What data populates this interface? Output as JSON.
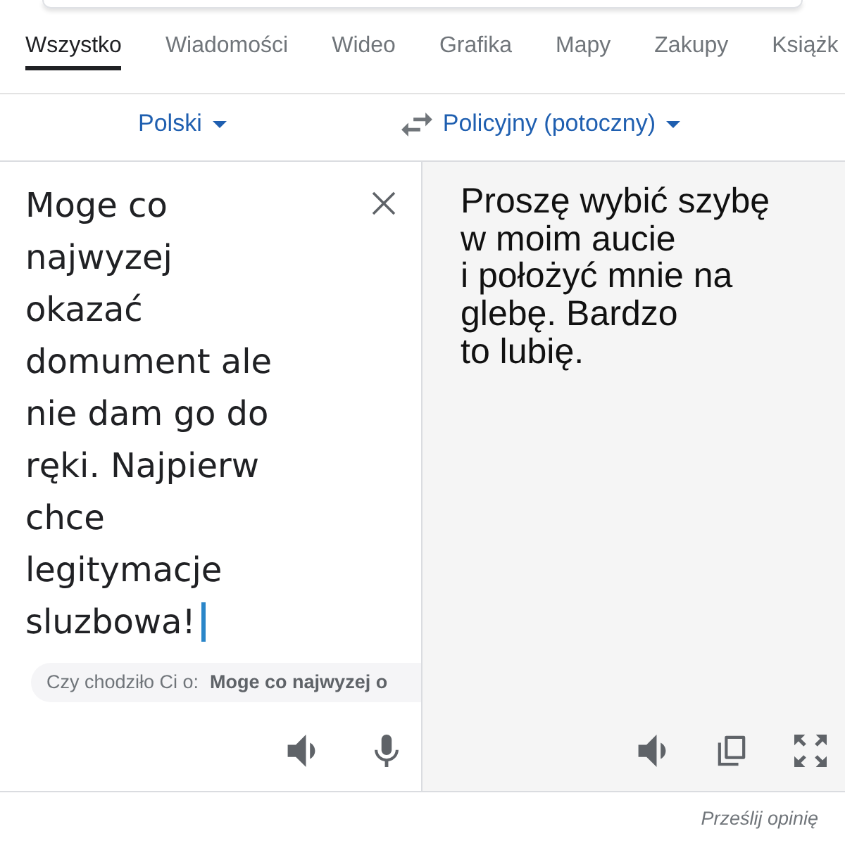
{
  "tabs": [
    {
      "label": "Wszystko",
      "selected": true
    },
    {
      "label": "Wiadomości",
      "selected": false
    },
    {
      "label": "Wideo",
      "selected": false
    },
    {
      "label": "Grafika",
      "selected": false
    },
    {
      "label": "Mapy",
      "selected": false
    },
    {
      "label": "Zakupy",
      "selected": false
    },
    {
      "label": "Książk",
      "selected": false
    }
  ],
  "languages": {
    "source": "Polski",
    "target": "Policyjny (potoczny)"
  },
  "source": {
    "text": "Moge co najwyzej okazać domument ale nie dam go do ręki. Najpierw chce legitymacje sluzbowa!",
    "focused": true,
    "suggestion_label": "Czy chodziło Ci o:",
    "suggestion": "Moge co najwyzej o"
  },
  "translation": {
    "text": "Proszę wybić szybę\nw moim aucie\ni położyć mnie na\nglebę. Bardzo\nto lubię."
  },
  "feedback_link": "Prześlij opinię"
}
